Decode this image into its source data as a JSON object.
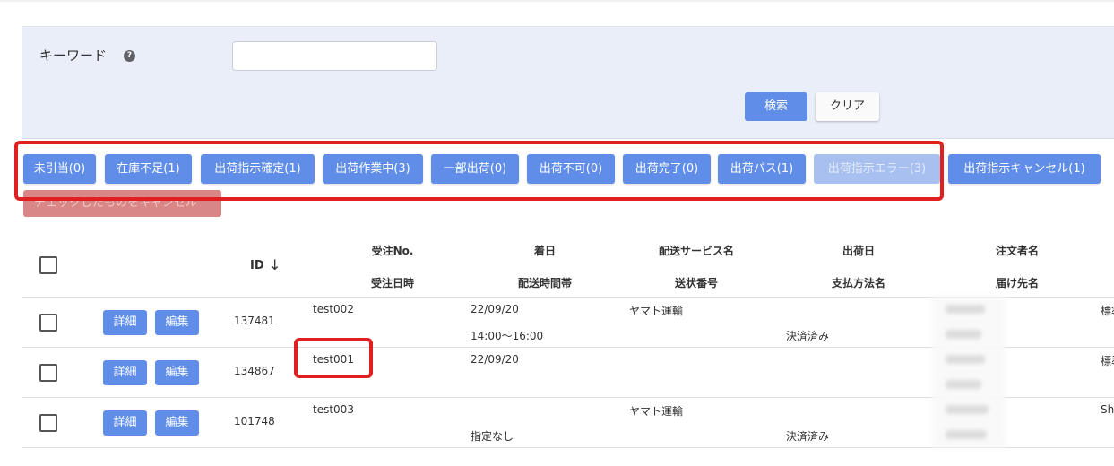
{
  "search": {
    "keyword_label": "キーワード",
    "help_icon": "?",
    "keyword_value": "",
    "keyword_placeholder": "",
    "search_button": "検索",
    "clear_button": "クリア"
  },
  "status_buttons": [
    {
      "label": "未引当(0)",
      "enabled": true
    },
    {
      "label": "在庫不足(1)",
      "enabled": true
    },
    {
      "label": "出荷指示確定(1)",
      "enabled": true
    },
    {
      "label": "出荷作業中(3)",
      "enabled": true
    },
    {
      "label": "一部出荷(0)",
      "enabled": true
    },
    {
      "label": "出荷不可(0)",
      "enabled": true
    },
    {
      "label": "出荷完了(0)",
      "enabled": true
    },
    {
      "label": "出荷パス(1)",
      "enabled": true
    },
    {
      "label": "出荷指示エラー(3)",
      "enabled": false
    },
    {
      "label": "出荷指示キャンセル(1)",
      "enabled": true
    }
  ],
  "bulk_cancel_button": "チェックしたものをキャンセル",
  "table": {
    "header_id": "ID",
    "sort_icon": "↓",
    "headers_top": [
      "受注No.",
      "着日",
      "配送サービス名",
      "出荷日",
      "注文者名"
    ],
    "headers_bottom": [
      "受注日時",
      "配送時間帯",
      "送状番号",
      "支払方法名",
      "届け先名"
    ],
    "detail_label": "詳細",
    "edit_label": "編集",
    "rows": [
      {
        "id": "137481",
        "order_no": "test002",
        "arrival_date": "22/09/20",
        "time_slot": "14:00〜16:00",
        "delivery_service": "ヤマト運輸",
        "payment": "決済済み",
        "extra": "標準"
      },
      {
        "id": "134867",
        "order_no": "test001",
        "arrival_date": "22/09/20",
        "time_slot": "",
        "delivery_service": "",
        "payment": "",
        "extra": "標準"
      },
      {
        "id": "101748",
        "order_no": "test003",
        "arrival_date": "",
        "time_slot": "指定なし",
        "delivery_service": "ヤマト運輸",
        "payment": "決済済み",
        "extra": "Sh"
      }
    ]
  },
  "colors": {
    "accent": "#5f8de8",
    "panel_bg": "#e9eef9",
    "highlight": "#e02020",
    "disabled": "#a7c0f0",
    "danger_disabled": "#d98786"
  }
}
